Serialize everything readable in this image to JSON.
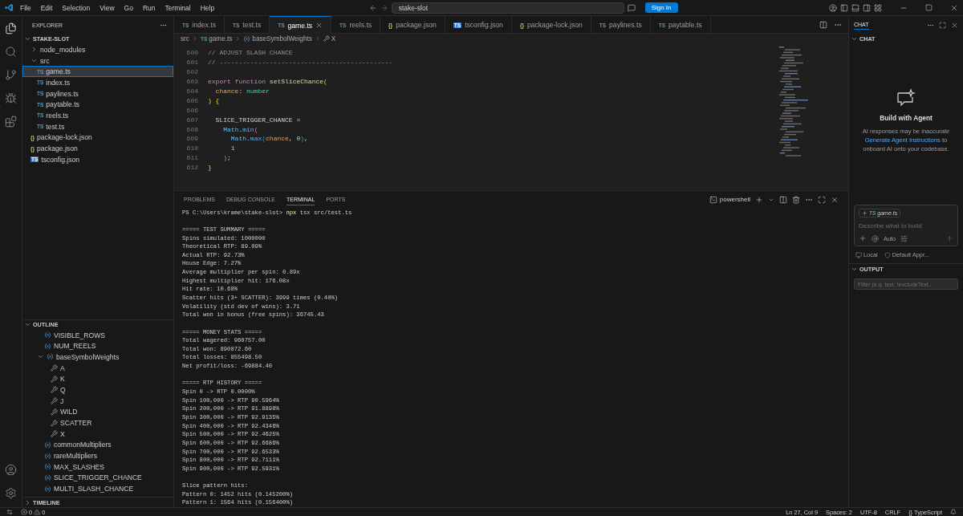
{
  "title_bar": {
    "menu": [
      "File",
      "Edit",
      "Selection",
      "View",
      "Go",
      "Run",
      "Terminal",
      "Help"
    ],
    "search": "stake-slot",
    "sign_in": "Sign In"
  },
  "explorer": {
    "title": "EXPLORER",
    "root": {
      "label": "STAKE-SLOT",
      "expanded": true,
      "children": [
        {
          "label": "node_modules",
          "kind": "folder",
          "expanded": false,
          "selected": false
        },
        {
          "label": "src",
          "kind": "folder",
          "expanded": true,
          "selected": false,
          "children": [
            {
              "label": "game.ts",
              "kind": "ts",
              "icon": "TS",
              "selected": true
            },
            {
              "label": "index.ts",
              "kind": "ts",
              "icon": "TS",
              "selected": false
            },
            {
              "label": "paylines.ts",
              "kind": "ts",
              "icon": "TS",
              "selected": false
            },
            {
              "label": "paytable.ts",
              "kind": "ts",
              "icon": "TS",
              "selected": false
            },
            {
              "label": "reels.ts",
              "kind": "ts",
              "icon": "TS",
              "selected": false
            },
            {
              "label": "test.ts",
              "kind": "ts",
              "icon": "TS",
              "selected": false
            }
          ]
        },
        {
          "label": "package-lock.json",
          "kind": "json",
          "icon": "{}",
          "selected": false
        },
        {
          "label": "package.json",
          "kind": "json",
          "icon": "{}",
          "selected": false
        },
        {
          "label": "tsconfig.json",
          "kind": "tsconfig",
          "icon": "TS",
          "selected": false
        }
      ]
    }
  },
  "outline": {
    "title": "OUTLINE",
    "expanded": true,
    "items": [
      {
        "label": "VISIBLE_ROWS",
        "kind": "variable"
      },
      {
        "label": "NUM_REELS",
        "kind": "variable"
      },
      {
        "label": "baseSymbolWeights",
        "kind": "variable",
        "expanded": true,
        "children": [
          {
            "label": "A",
            "kind": "property"
          },
          {
            "label": "K",
            "kind": "property"
          },
          {
            "label": "Q",
            "kind": "property"
          },
          {
            "label": "J",
            "kind": "property"
          },
          {
            "label": "WILD",
            "kind": "property"
          },
          {
            "label": "SCATTER",
            "kind": "property"
          },
          {
            "label": "X",
            "kind": "property"
          }
        ]
      },
      {
        "label": "commonMultipliers",
        "kind": "variable"
      },
      {
        "label": "rareMultipliers",
        "kind": "variable"
      },
      {
        "label": "MAX_SLASHES",
        "kind": "variable"
      },
      {
        "label": "SLICE_TRIGGER_CHANCE",
        "kind": "variable"
      },
      {
        "label": "MULTI_SLASH_CHANCE",
        "kind": "variable"
      }
    ]
  },
  "timeline": {
    "title": "TIMELINE",
    "expanded": false
  },
  "tabs": [
    {
      "label": "index.ts",
      "kind": "ts",
      "icon": "TS",
      "selected": false
    },
    {
      "label": "test.ts",
      "kind": "ts",
      "icon": "TS",
      "selected": false
    },
    {
      "label": "game.ts",
      "kind": "ts",
      "icon": "TS",
      "selected": true
    },
    {
      "label": "reels.ts",
      "kind": "ts",
      "icon": "TS",
      "selected": false
    },
    {
      "label": "package.json",
      "kind": "json",
      "icon": "{}",
      "selected": false
    },
    {
      "label": "tsconfig.json",
      "kind": "tsconfig",
      "icon": "TS",
      "selected": false
    },
    {
      "label": "package-lock.json",
      "kind": "json",
      "icon": "{}",
      "selected": false
    },
    {
      "label": "paylines.ts",
      "kind": "ts",
      "icon": "TS",
      "selected": false
    },
    {
      "label": "paytable.ts",
      "kind": "ts",
      "icon": "TS",
      "selected": false
    }
  ],
  "breadcrumbs": [
    {
      "label": "src",
      "kind": "folder"
    },
    {
      "label": "game.ts",
      "kind": "file",
      "icon": "TS"
    },
    {
      "label": "baseSymbolWeights",
      "kind": "variable"
    },
    {
      "label": "X",
      "kind": "property"
    }
  ],
  "code": [
    {
      "line": "600",
      "tokens": [
        {
          "t": "// ADJUST SLASH CHANCE",
          "kind": "comment"
        }
      ]
    },
    {
      "line": "601",
      "tokens": [
        {
          "t": "// ---------------------------------------------",
          "kind": "comment"
        }
      ]
    },
    {
      "line": "602"
    },
    {
      "line": "603",
      "tokens": [
        {
          "t": "export",
          "kind": "keyword"
        },
        {
          "t": " function",
          "kind": "keyword"
        },
        {
          "t": " setSliceChance",
          "kind": "func"
        },
        {
          "t": "(",
          "kind": "bracket1"
        }
      ]
    },
    {
      "line": "604",
      "tokens": [
        {
          "t": "  chance",
          "kind": "param"
        },
        {
          "t": ":",
          "kind": "plain"
        },
        {
          "t": " number",
          "kind": "type"
        }
      ]
    },
    {
      "line": "605",
      "tokens": [
        {
          "t": ")",
          "kind": "bracket1"
        },
        {
          "t": " {",
          "kind": "bracket1"
        }
      ]
    },
    {
      "line": "606"
    },
    {
      "line": "607",
      "tokens": [
        {
          "t": "  SLICE_TRIGGER_CHANCE",
          "kind": "plain"
        },
        {
          "t": " =",
          "kind": "plain"
        }
      ]
    },
    {
      "line": "608",
      "tokens": [
        {
          "t": "    Math",
          "kind": "class"
        },
        {
          "t": ".",
          "kind": "plain"
        },
        {
          "t": "min",
          "kind": "method"
        },
        {
          "t": "(",
          "kind": "bracket2"
        }
      ]
    },
    {
      "line": "609",
      "tokens": [
        {
          "t": "      Math",
          "kind": "class"
        },
        {
          "t": ".",
          "kind": "plain"
        },
        {
          "t": "max",
          "kind": "method"
        },
        {
          "t": "(",
          "kind": "bracket3"
        },
        {
          "t": "chance",
          "kind": "param"
        },
        {
          "t": ",",
          "kind": "plain"
        },
        {
          "t": " 0",
          "kind": "num"
        },
        {
          "t": ")",
          "kind": "bracket3"
        },
        {
          "t": ",",
          "kind": "plain"
        }
      ]
    },
    {
      "line": "610",
      "tokens": [
        {
          "t": "      1",
          "kind": "num"
        }
      ]
    },
    {
      "line": "611",
      "tokens": [
        {
          "t": "    )",
          "kind": "bracket2"
        },
        {
          "t": ";",
          "kind": "plain"
        }
      ]
    },
    {
      "line": "612",
      "tokens": [
        {
          "t": "}",
          "kind": "bracket1"
        }
      ]
    }
  ],
  "panel": {
    "tabs": [
      {
        "label": "PROBLEMS",
        "selected": false
      },
      {
        "label": "DEBUG CONSOLE",
        "selected": false
      },
      {
        "label": "TERMINAL",
        "selected": true
      },
      {
        "label": "PORTS",
        "selected": false
      }
    ],
    "terminal_name": "powershell",
    "lines": [
      {
        "kind": "prompt",
        "prompt": "PS C:\\Users\\krame\\stake-slot>",
        "command": "npx",
        "args": "tsx src/test.ts"
      },
      {
        "kind": "blank"
      },
      {
        "kind": "output",
        "text": "===== TEST SUMMARY ====="
      },
      {
        "kind": "output",
        "text": "Spins simulated: 1000000"
      },
      {
        "kind": "output",
        "text": "Theoretical RTP: 89.09%"
      },
      {
        "kind": "output",
        "text": "Actual RTP: 92.73%"
      },
      {
        "kind": "output",
        "text": "House Edge: 7.27%"
      },
      {
        "kind": "output",
        "text": "Average multiplier per spin: 0.89x"
      },
      {
        "kind": "output",
        "text": "Highest multiplier hit: 176.08x"
      },
      {
        "kind": "output",
        "text": "Hit rate: 10.68%"
      },
      {
        "kind": "output",
        "text": "Scatter hits (3+ SCATTER): 3999 times (0.40%)"
      },
      {
        "kind": "output",
        "text": "Volatility (std dev of wins): 3.71"
      },
      {
        "kind": "output",
        "text": "Total won in bonus (free spins): 36745.43"
      },
      {
        "kind": "blank"
      },
      {
        "kind": "output",
        "text": "===== MONEY STATS ====="
      },
      {
        "kind": "output",
        "text": "Total wagered: 960757.00"
      },
      {
        "kind": "output",
        "text": "Total won: 890872.60"
      },
      {
        "kind": "output",
        "text": "Total losses: 855498.50"
      },
      {
        "kind": "output",
        "text": "Net profit/loss: -69884.40"
      },
      {
        "kind": "blank"
      },
      {
        "kind": "output",
        "text": "===== RTP HISTORY ====="
      },
      {
        "kind": "output",
        "text": "Spin 0 -> RTP 0.0000%"
      },
      {
        "kind": "output",
        "text": "Spin 100,000 -> RTP 90.5964%"
      },
      {
        "kind": "output",
        "text": "Spin 200,000 -> RTP 91.8898%"
      },
      {
        "kind": "output",
        "text": "Spin 300,000 -> RTP 92.9135%"
      },
      {
        "kind": "output",
        "text": "Spin 400,000 -> RTP 92.4346%"
      },
      {
        "kind": "output",
        "text": "Spin 500,000 -> RTP 92.4625%"
      },
      {
        "kind": "output",
        "text": "Spin 600,000 -> RTP 92.6686%"
      },
      {
        "kind": "output",
        "text": "Spin 700,000 -> RTP 92.6533%"
      },
      {
        "kind": "output",
        "text": "Spin 800,000 -> RTP 92.7111%"
      },
      {
        "kind": "output",
        "text": "Spin 900,000 -> RTP 92.5931%"
      },
      {
        "kind": "blank"
      },
      {
        "kind": "output",
        "text": "Slice pattern hits:"
      },
      {
        "kind": "output",
        "text": "Pattern 0: 1452 hits (0.145200%)"
      },
      {
        "kind": "output",
        "text": "Pattern 1: 1564 hits (0.156400%)"
      }
    ]
  },
  "chat": {
    "tab": "CHAT",
    "section": "CHAT",
    "heading": "Build with Agent",
    "text_before": "AI responses may be inaccurate",
    "link": "Generate Agent Instructions",
    "text_after": "to onboard AI onto your codebase.",
    "context_icon": "TS",
    "context_file": "game.ts",
    "placeholder": "Describe what to build",
    "mode": "Auto",
    "location": "Local",
    "approvals": "Default Appr..."
  },
  "output": {
    "title": "OUTPUT",
    "expanded": true,
    "placeholder": "Filter (e.g. text, !excludeText..."
  },
  "status_bar": {
    "errors": "0",
    "warnings": "0",
    "position": "Ln 27, Col 9",
    "spaces": "Spaces: 2",
    "encoding": "UTF-8",
    "eol": "CRLF",
    "language_icon": "{}",
    "language": "TypeScript"
  }
}
